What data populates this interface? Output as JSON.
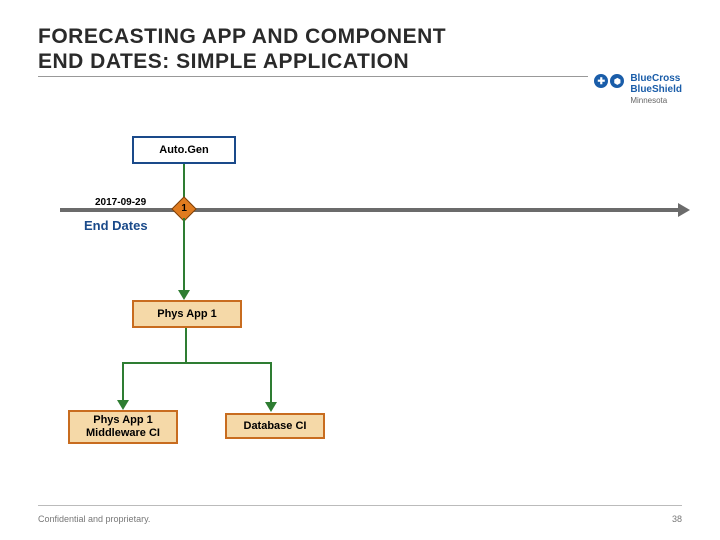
{
  "title_line1": "FORECASTING APP AND COMPONENT",
  "title_line2": "END DATES: SIMPLE APPLICATION",
  "logo": {
    "line1": "BlueCross",
    "line2": "BlueShield",
    "sub": "Minnesota"
  },
  "timeline": {
    "date": "2017-09-29",
    "marker": "1",
    "label": "End Dates"
  },
  "boxes": {
    "autogen": "Auto.Gen",
    "physapp": "Phys App 1",
    "middleware": "Phys App 1\nMiddleware CI",
    "database": "Database CI"
  },
  "footer": {
    "left": "Confidential and proprietary.",
    "right": "38"
  }
}
